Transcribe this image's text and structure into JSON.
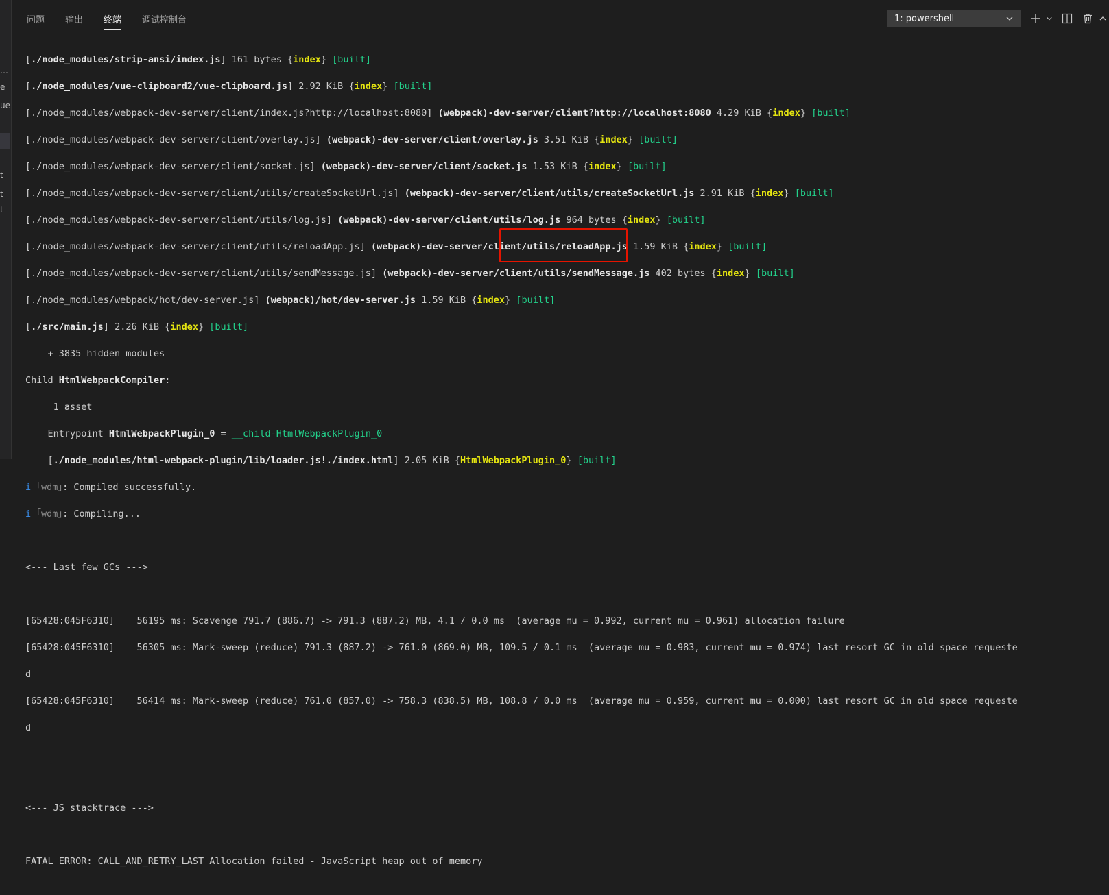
{
  "left_strip": [
    "…",
    "e",
    "ue",
    "t",
    "t",
    "t"
  ],
  "tabs": {
    "problems": "问题",
    "output": "输出",
    "terminal": "终端",
    "debug_console": "调试控制台"
  },
  "terminal_select": {
    "value": "1: powershell"
  },
  "terminal": {
    "lines": {
      "l1": {
        "path": "./node_modules/strip-ansi/index.js",
        "size": "161 bytes",
        "chunk": "index",
        "status": "[built]"
      },
      "l2": {
        "path": "./node_modules/vue-clipboard2/vue-clipboard.js",
        "size": "2.92 KiB",
        "chunk": "index",
        "status": "[built]"
      },
      "l3": {
        "path": "./node_modules/webpack-dev-server/client/index.js?http://localhost:8080",
        "name": "(webpack)-dev-server/client?http://localhost:8080",
        "size": "4.29 KiB",
        "chunk": "index",
        "status": "[built]"
      },
      "l4": {
        "path": "./node_modules/webpack-dev-server/client/overlay.js",
        "name": "(webpack)-dev-server/client/overlay.js",
        "size": "3.51 KiB",
        "chunk": "index",
        "status": "[built]"
      },
      "l5": {
        "path": "./node_modules/webpack-dev-server/client/socket.js",
        "name": "(webpack)-dev-server/client/socket.js",
        "size": "1.53 KiB",
        "chunk": "index",
        "status": "[built]"
      },
      "l6": {
        "path": "./node_modules/webpack-dev-server/client/utils/createSocketUrl.js",
        "name": "(webpack)-dev-server/client/utils/createSocketUrl.js",
        "size": "2.91 KiB",
        "chunk": "index",
        "status": "[built]"
      },
      "l7": {
        "path": "./node_modules/webpack-dev-server/client/utils/log.js",
        "name": "(webpack)-dev-server/client/utils/log.js",
        "size": "964 bytes",
        "chunk": "index",
        "status": "[built]"
      },
      "l8": {
        "path": "./node_modules/webpack-dev-server/client/utils/reloadApp.js",
        "name": "(webpack)-dev-server/client/utils/reloadApp.js",
        "size": "1.59 KiB",
        "chunk": "index",
        "status": "[built]"
      },
      "l9": {
        "path": "./node_modules/webpack-dev-server/client/utils/sendMessage.js",
        "name": "(webpack)-dev-server/client/utils/sendMessage.js",
        "size": "402 bytes",
        "chunk": "index",
        "status": "[built]"
      },
      "l10": {
        "path": "./node_modules/webpack/hot/dev-server.js",
        "name": "(webpack)/hot/dev-server.js",
        "size": "1.59 KiB",
        "chunk": "index",
        "status": "[built]"
      },
      "l11": {
        "path": "./src/main.js",
        "size": "2.26 KiB",
        "chunk": "index",
        "status": "[built]"
      },
      "hidden": "    + 3835 hidden modules",
      "child_prefix": "Child ",
      "child_name": "HtmlWebpackCompiler",
      "asset": "     1 asset",
      "entry_prefix": "    Entrypoint ",
      "entry_name": "HtmlWebpackPlugin_0",
      "entry_eq": " = ",
      "entry_child": "__child-HtmlWebpackPlugin_0",
      "loader_path": "./node_modules/html-webpack-plugin/lib/loader.js!./index.html",
      "loader_size": "2.05 KiB",
      "loader_chunk": "HtmlWebpackPlugin_0",
      "loader_status": "[built]",
      "wdm1_i": "i",
      "wdm1_tag": "｢wdm｣",
      "wdm1_msg": ": Compiled successfully.",
      "wdm2_i": "i",
      "wdm2_tag": "｢wdm｣",
      "wdm2_msg": ": Compiling...",
      "gc_header": "<--- Last few GCs --->",
      "gc1": "[65428:045F6310]    56195 ms: Scavenge 791.7 (886.7) -> 791.3 (887.2) MB, 4.1 / 0.0 ms  (average mu = 0.992, current mu = 0.961) allocation failure",
      "gc2": "[65428:045F6310]    56305 ms: Mark-sweep (reduce) 791.3 (887.2) -> 761.0 (869.0) MB, 109.5 / 0.1 ms  (average mu = 0.983, current mu = 0.974) last resort GC in old space requeste",
      "gc2b": "d",
      "gc3": "[65428:045F6310]    56414 ms: Mark-sweep (reduce) 761.0 (857.0) -> 758.3 (838.5) MB, 108.8 / 0.0 ms  (average mu = 0.959, current mu = 0.000) last resort GC in old space requeste",
      "gc3b": "d",
      "js_header": "<--- JS stacktrace --->",
      "fatal": "FATAL ERROR: CALL_AND_RETRY_LAST Allocation failed - JavaScript heap out of memory"
    }
  },
  "colors": {
    "background": "#1e1e1e",
    "text": "#cccccc",
    "chunk_yellow": "#e5e510",
    "built_green": "#23d18b",
    "highlight_red": "#e51400"
  }
}
